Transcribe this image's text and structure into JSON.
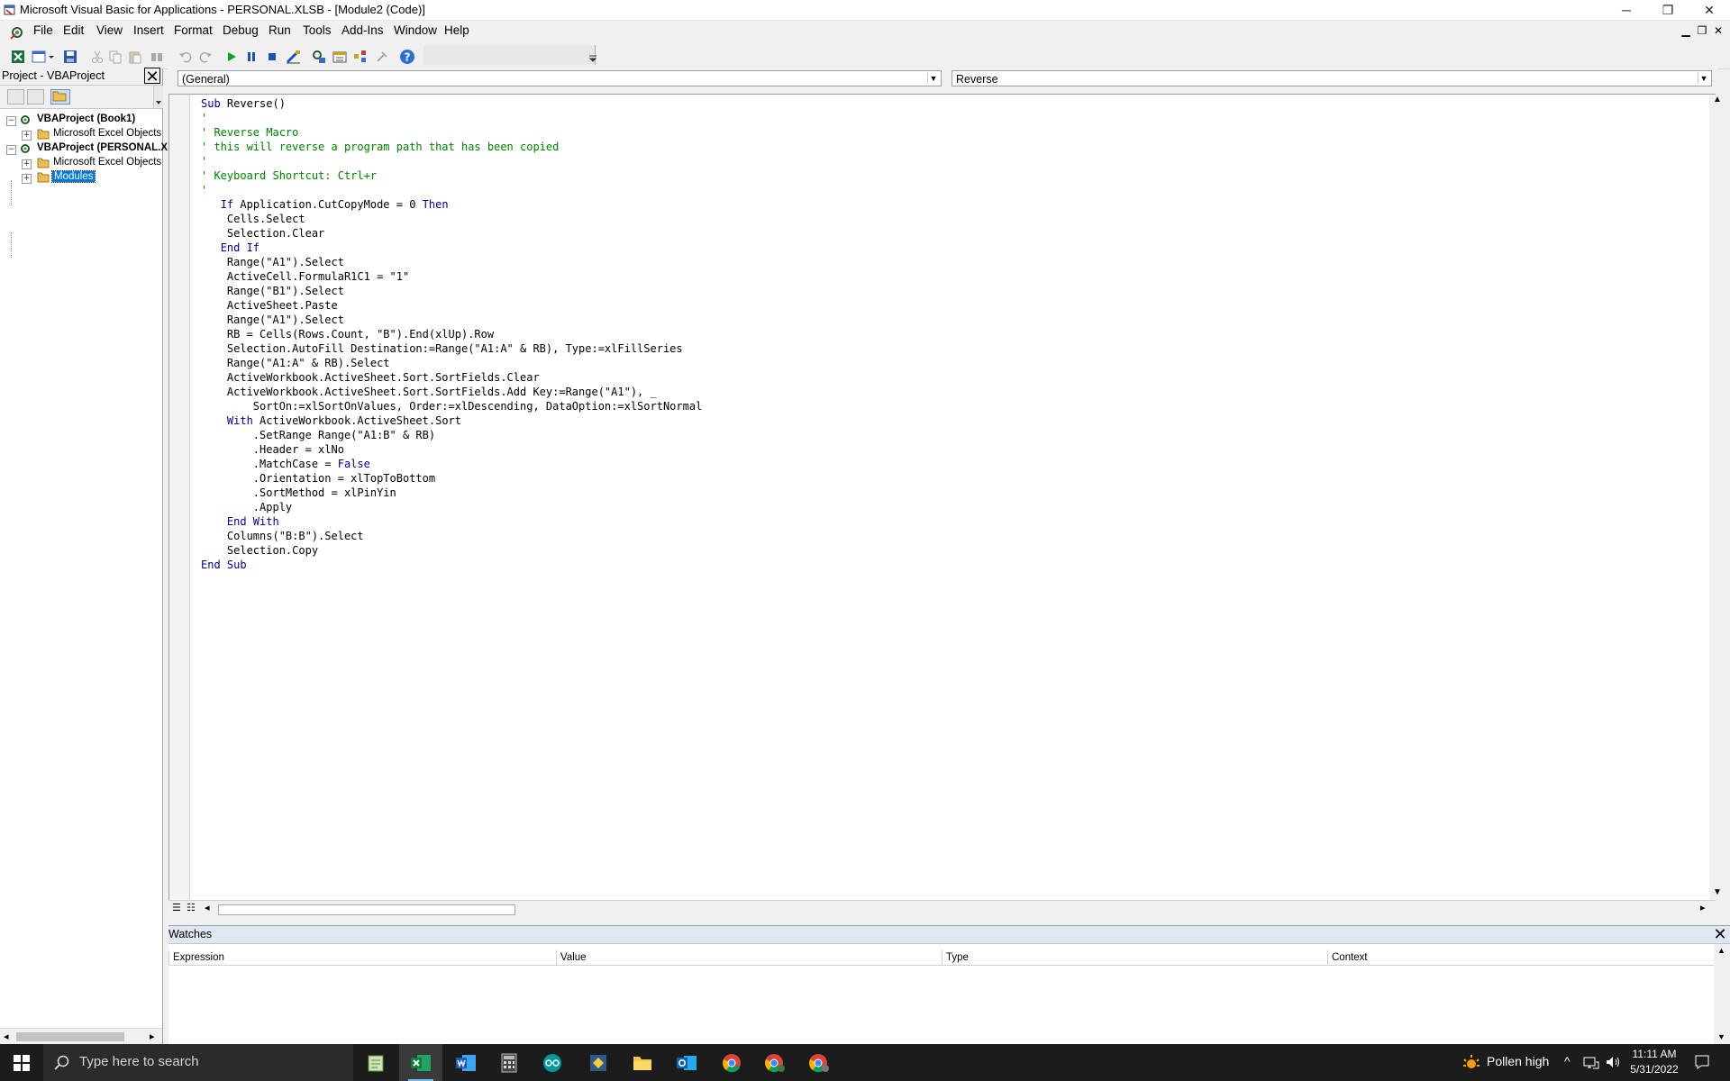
{
  "window": {
    "title": "Microsoft Visual Basic for Applications - PERSONAL.XLSB - [Module2 (Code)]",
    "controls": {
      "minimize": "─",
      "restore": "❐",
      "close": "✕"
    }
  },
  "menu": {
    "items": [
      {
        "label": "File"
      },
      {
        "label": "Edit"
      },
      {
        "label": "View"
      },
      {
        "label": "Insert"
      },
      {
        "label": "Format"
      },
      {
        "label": "Debug"
      },
      {
        "label": "Run"
      },
      {
        "label": "Tools"
      },
      {
        "label": "Add-Ins"
      },
      {
        "label": "Window"
      },
      {
        "label": "Help"
      }
    ],
    "mdi_controls": {
      "minimize": "▁",
      "restore": "❐",
      "close": "✕"
    }
  },
  "toolbar": {
    "buttons": [
      "view-excel-icon",
      "insert-userform-icon",
      "save-icon",
      "cut-icon",
      "copy-icon",
      "paste-icon",
      "find-icon",
      "undo-icon",
      "redo-icon",
      "run-icon",
      "break-icon",
      "reset-icon",
      "design-mode-icon",
      "project-explorer-icon",
      "properties-window-icon",
      "object-browser-icon",
      "toolbox-icon",
      "help-icon"
    ]
  },
  "project": {
    "title": "Project - VBAProject",
    "close": "✕",
    "tree": [
      {
        "label": "VBAProject (Book1)",
        "bold": true,
        "level": 0,
        "expander": "−",
        "icon": "vba-project-icon"
      },
      {
        "label": "Microsoft Excel Objects",
        "bold": false,
        "level": 1,
        "expander": "+",
        "icon": "folder-icon"
      },
      {
        "label": "VBAProject (PERSONAL.X",
        "bold": true,
        "level": 0,
        "expander": "−",
        "icon": "vba-project-icon"
      },
      {
        "label": "Microsoft Excel Objects",
        "bold": false,
        "level": 1,
        "expander": "+",
        "icon": "folder-icon"
      },
      {
        "label": "Modules",
        "bold": false,
        "level": 1,
        "expander": "+",
        "icon": "folder-icon",
        "selected": true
      }
    ]
  },
  "code": {
    "object_combo": "(General)",
    "procedure_combo": "Reverse",
    "lines": [
      [
        {
          "t": "Sub",
          "k": "kw"
        },
        {
          "t": " Reverse()"
        }
      ],
      [
        {
          "t": "'",
          "k": "cm"
        }
      ],
      [
        {
          "t": "' Reverse Macro",
          "k": "cm"
        }
      ],
      [
        {
          "t": "' this will reverse a program path that has been copied",
          "k": "cm"
        }
      ],
      [
        {
          "t": "'",
          "k": "cm"
        }
      ],
      [
        {
          "t": "' Keyboard Shortcut: Ctrl+r",
          "k": "cm"
        }
      ],
      [
        {
          "t": "'",
          "k": "cm"
        }
      ],
      [
        {
          "t": "   "
        },
        {
          "t": "If",
          "k": "kw"
        },
        {
          "t": " Application.CutCopyMode = 0 "
        },
        {
          "t": "Then",
          "k": "kw"
        }
      ],
      [
        {
          "t": "    Cells.Select"
        }
      ],
      [
        {
          "t": "    Selection.Clear"
        }
      ],
      [
        {
          "t": "   "
        },
        {
          "t": "End If",
          "k": "kw"
        }
      ],
      [
        {
          "t": "    Range(\"A1\").Select"
        }
      ],
      [
        {
          "t": "    ActiveCell.FormulaR1C1 = \"1\""
        }
      ],
      [
        {
          "t": "    Range(\"B1\").Select"
        }
      ],
      [
        {
          "t": "    ActiveSheet.Paste"
        }
      ],
      [
        {
          "t": "    Range(\"A1\").Select"
        }
      ],
      [
        {
          "t": "    RB = Cells(Rows.Count, \"B\").End(xlUp).Row"
        }
      ],
      [
        {
          "t": "    Selection.AutoFill Destination:=Range(\"A1:A\" & RB), Type:=xlFillSeries"
        }
      ],
      [
        {
          "t": "    Range(\"A1:A\" & RB).Select"
        }
      ],
      [
        {
          "t": "    ActiveWorkbook.ActiveSheet.Sort.SortFields.Clear"
        }
      ],
      [
        {
          "t": "    ActiveWorkbook.ActiveSheet.Sort.SortFields.Add Key:=Range(\"A1\"), _"
        }
      ],
      [
        {
          "t": "        SortOn:=xlSortOnValues, Order:=xlDescending, DataOption:=xlSortNormal"
        }
      ],
      [
        {
          "t": "    "
        },
        {
          "t": "With",
          "k": "kw"
        },
        {
          "t": " ActiveWorkbook.ActiveSheet.Sort"
        }
      ],
      [
        {
          "t": "        .SetRange Range(\"A1:B\" & RB)"
        }
      ],
      [
        {
          "t": "        .Header = xlNo"
        }
      ],
      [
        {
          "t": "        .MatchCase = "
        },
        {
          "t": "False",
          "k": "kw"
        }
      ],
      [
        {
          "t": "        .Orientation = xlTopToBottom"
        }
      ],
      [
        {
          "t": "        .SortMethod = xlPinYin"
        }
      ],
      [
        {
          "t": "        .Apply"
        }
      ],
      [
        {
          "t": "    "
        },
        {
          "t": "End With",
          "k": "kw"
        }
      ],
      [
        {
          "t": "    Columns(\"B:B\").Select"
        }
      ],
      [
        {
          "t": "    Selection.Copy"
        }
      ],
      [
        {
          "t": "End Sub",
          "k": "kw"
        }
      ]
    ]
  },
  "watches": {
    "title": "Watches",
    "close": "✕",
    "columns": [
      "Expression",
      "Value",
      "Type",
      "Context"
    ]
  },
  "taskbar": {
    "search_placeholder": "Type here to search",
    "apps": [
      "notepad-icon",
      "excel-icon",
      "word-icon",
      "calculator-icon",
      "arduino-icon",
      "python-icon",
      "file-explorer-icon",
      "outlook-icon",
      "chrome-icon",
      "chrome-profile-icon",
      "chrome-profile-2-icon"
    ],
    "weather": "Pollen high",
    "time": "11:11 AM",
    "date": "5/31/2022"
  },
  "colors": {
    "keyword": "#00008b",
    "comment": "#008000",
    "selection": "#0078d7"
  }
}
